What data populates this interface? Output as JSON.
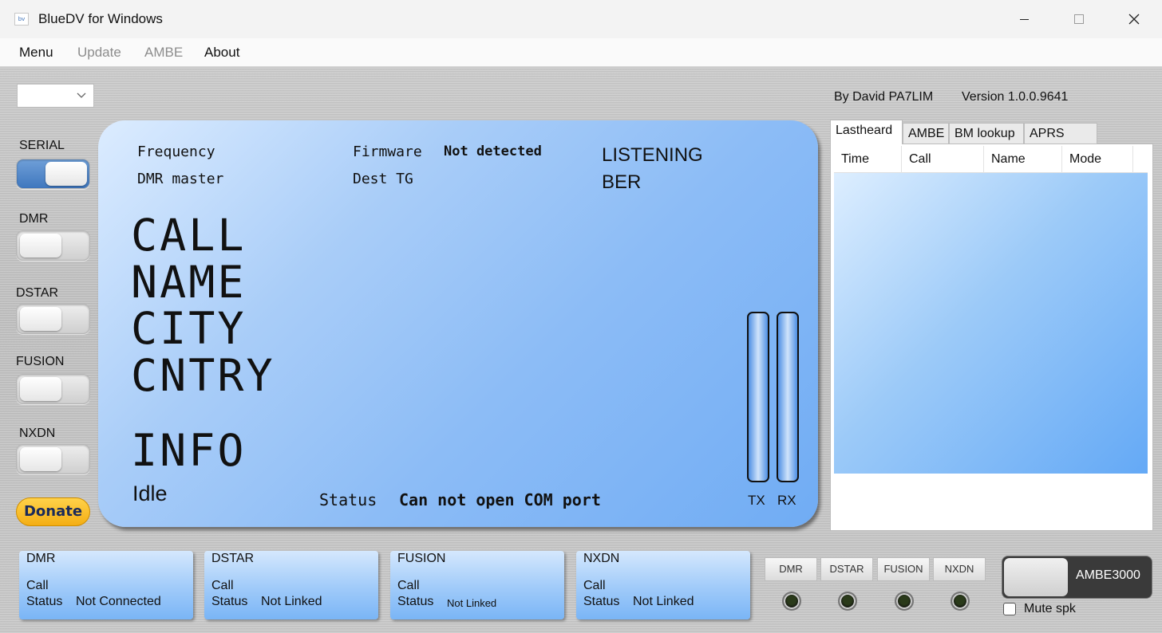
{
  "window": {
    "title": "BlueDV for Windows",
    "icon_text": "bv"
  },
  "menu": {
    "items": [
      {
        "label": "Menu",
        "enabled": true
      },
      {
        "label": "Update",
        "enabled": false
      },
      {
        "label": "AMBE",
        "enabled": false
      },
      {
        "label": "About",
        "enabled": true
      }
    ]
  },
  "header": {
    "byline": "By David PA7LIM",
    "version": "Version 1.0.0.9641",
    "port_combo_value": ""
  },
  "modes": [
    {
      "label": "SERIAL",
      "on": true
    },
    {
      "label": "DMR",
      "on": false
    },
    {
      "label": "DSTAR",
      "on": false
    },
    {
      "label": "FUSION",
      "on": false
    },
    {
      "label": "NXDN",
      "on": false
    }
  ],
  "donate_label": "Donate",
  "lcd": {
    "frequency_label": "Frequency",
    "dmr_master_label": "DMR master",
    "firmware_label": "Firmware",
    "firmware_value": "Not detected",
    "dest_tg_label": "Dest TG",
    "listening": "LISTENING",
    "ber": "BER",
    "call": "CALL",
    "name": "NAME",
    "city": "CITY",
    "cntry": "CNTRY",
    "info": "INFO",
    "idle": "Idle",
    "status_label": "Status",
    "status_value": "Can not open COM port",
    "tx_label": "TX",
    "rx_label": "RX",
    "tx_level": 0,
    "rx_level": 0
  },
  "side_panel": {
    "tabs": [
      "Lastheard",
      "AMBE",
      "BM lookup",
      "APRS chat"
    ],
    "active_tab": "Lastheard",
    "columns": [
      "Time",
      "Call",
      "Name",
      "Mode"
    ]
  },
  "status_cards": [
    {
      "title": "DMR",
      "call_label": "Call",
      "status_label": "Status",
      "status_value": "Not Connected"
    },
    {
      "title": "DSTAR",
      "call_label": "Call",
      "status_label": "Status",
      "status_value": "Not Linked"
    },
    {
      "title": "FUSION",
      "call_label": "Call",
      "status_label": "Status",
      "status_value": "Not Linked"
    },
    {
      "title": "NXDN",
      "call_label": "Call",
      "status_label": "Status",
      "status_value": "Not Linked"
    }
  ],
  "mode_buttons": [
    "DMR",
    "DSTAR",
    "FUSION",
    "NXDN"
  ],
  "ambe_switch": {
    "label": "AMBE3000",
    "on": false
  },
  "mute": {
    "label": "Mute spk",
    "checked": false
  },
  "colors": {
    "lcd_blue": "#8cbcf6",
    "donate_yellow": "#f4ae14",
    "toggle_on_blue": "#3f77be"
  }
}
